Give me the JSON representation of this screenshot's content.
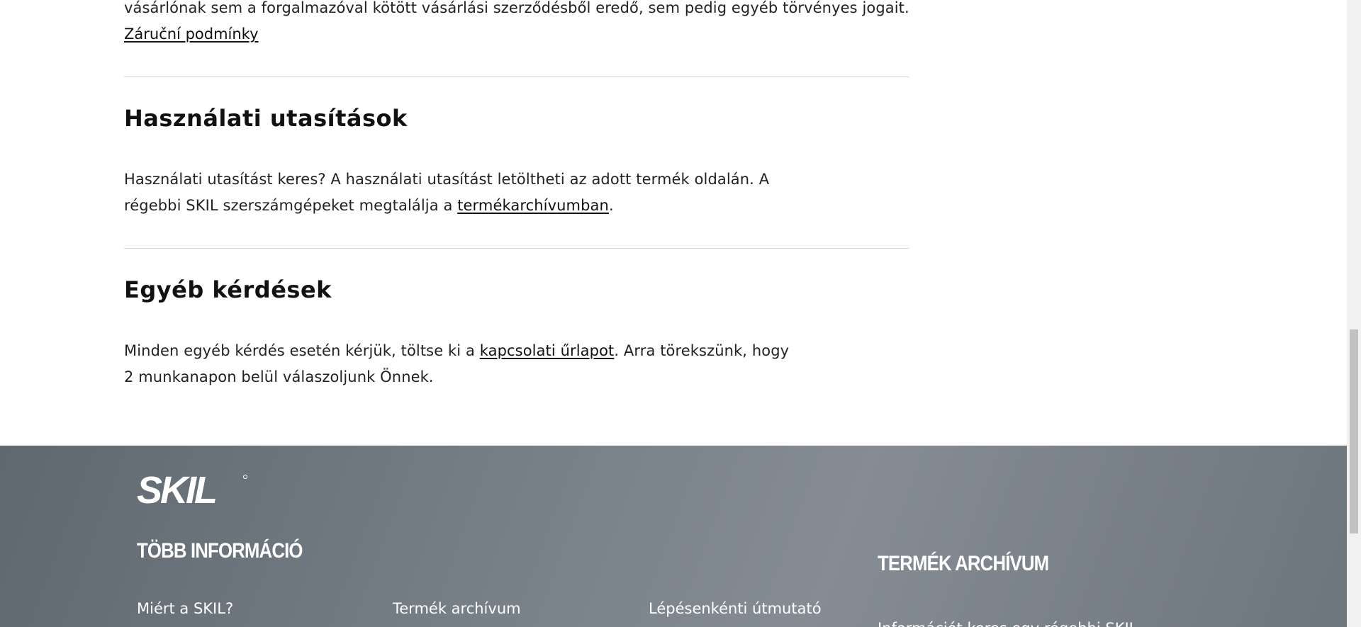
{
  "warranty": {
    "text_line": "vásárlónak sem a forgalmazóval kötött vásárlási szerződésből eredő, sem pedig egyéb törvényes jogait.",
    "link": "Záruční podmínky"
  },
  "manuals": {
    "title": "Használati utasítások",
    "text_before": "Használati utasítást keres? A használati utasítást letöltheti az adott termék oldalán. A régebbi SKIL szerszámgépeket megtalálja a ",
    "link": "termékarchívumban",
    "text_after": "."
  },
  "other": {
    "title": "Egyéb kérdések",
    "text_before": "Minden egyéb kérdés esetén kérjük, töltse ki a ",
    "link": "kapcsolati űrlapot",
    "text_after": ". Arra törekszünk, hogy 2 munkanapon belül válaszoljunk Önnek."
  },
  "footer": {
    "logo_text": "SKIL",
    "more_info_heading": "TÖBB INFORMÁCIÓ",
    "links": [
      "Miért a SKIL?",
      "Termék archívum",
      "Lépésenkénti útmutató"
    ],
    "archive_heading": "TERMÉK ARCHÍVUM",
    "archive_text": "Információt keres egy régebbi SKIL"
  },
  "colors": {
    "footer_bg": "#737b83",
    "text": "#222222",
    "divider": "#d4d4d4"
  }
}
